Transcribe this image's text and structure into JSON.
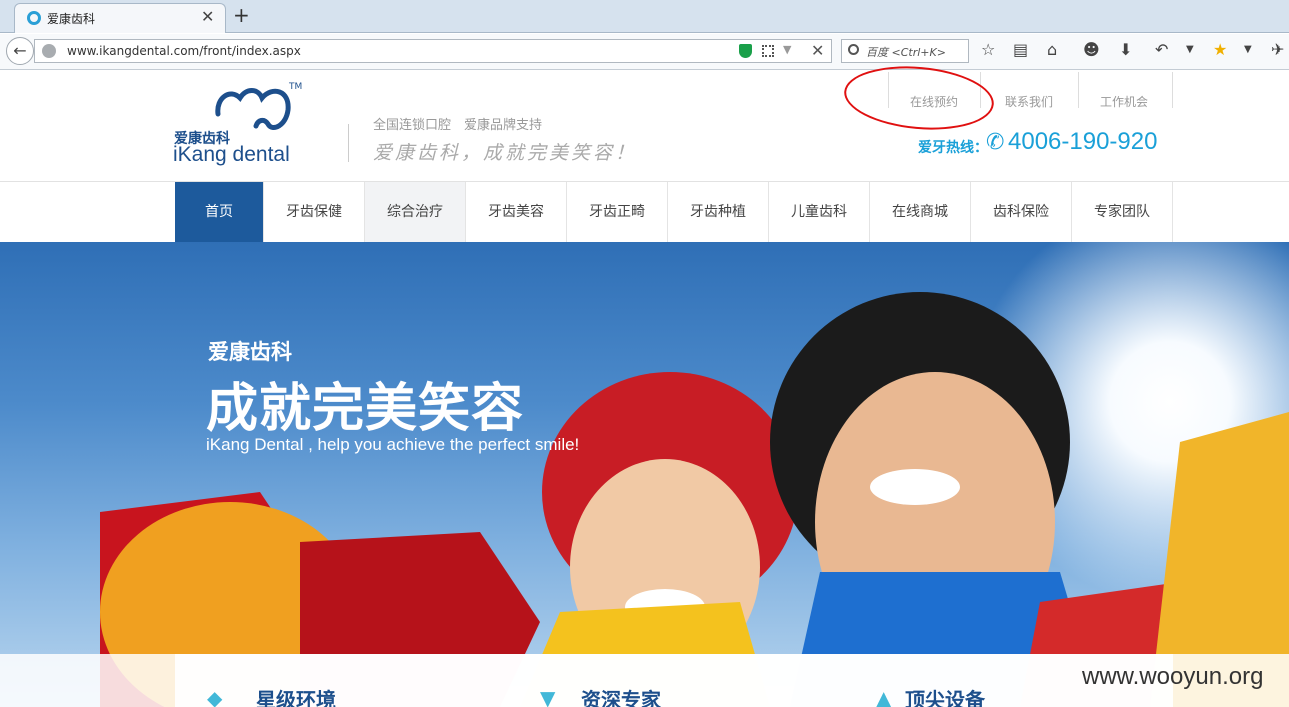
{
  "browser": {
    "tab_title": "爱康齿科",
    "url": "www.ikangdental.com/front/index.aspx",
    "search_placeholder": "百度 <Ctrl+K>"
  },
  "header": {
    "logo_cn": "爱康齿科",
    "logo_en": "iKang dental",
    "logo_tm": "TM",
    "tagline_1": "全国连锁口腔　爱康品牌支持",
    "tagline_2": "爱康齿科，成就完美笑容！",
    "top_links": [
      "在线预约",
      "联系我们",
      "工作机会"
    ],
    "hotline_label": "爱牙热线：",
    "hotline_number": "4006-190-920"
  },
  "menu": {
    "items": [
      "首页",
      "牙齿保健",
      "综合治疗",
      "牙齿美容",
      "牙齿正畸",
      "牙齿种植",
      "儿童齿科",
      "在线商城",
      "齿科保险",
      "专家团队"
    ],
    "active_index": 0
  },
  "hero": {
    "title_small": "爱康齿科",
    "title_big": "成就完美笑容",
    "subtitle": "iKang Dental , help you achieve the perfect smile!"
  },
  "features": [
    "星级环境",
    "资深专家",
    "顶尖设备"
  ],
  "watermark": "www.wooyun.org",
  "colors": {
    "brand_blue": "#1d5a9c",
    "hotline_cyan": "#1aa0d8",
    "annotation_red": "#e01010"
  }
}
